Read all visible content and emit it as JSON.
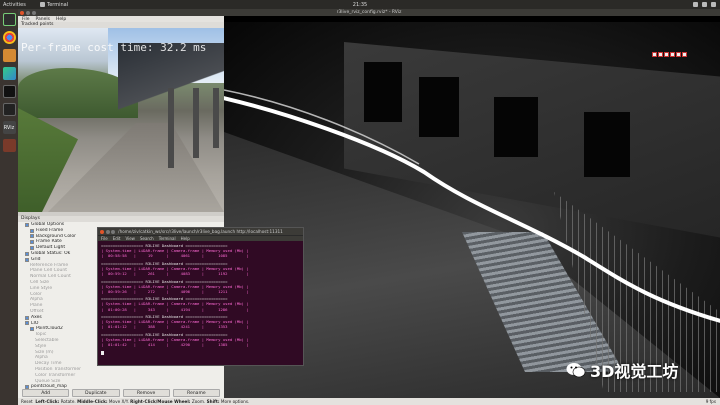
{
  "topbar": {
    "activities": "Activities",
    "app": "Terminal",
    "clock": "21:35"
  },
  "dock": {
    "rviz_label": "RViz"
  },
  "rviz": {
    "window_title": "r3live_rviz_config.rviz* - RViz",
    "menu": [
      "File",
      "Panels",
      "Help"
    ],
    "tracked_points_title": "Tracked points",
    "overlay_text": "Per-frame cost time: 32.2 ms"
  },
  "displays": {
    "title": "Displays",
    "rows": [
      {
        "label": "Global Options",
        "indent": 1,
        "dim": false
      },
      {
        "label": "Fixed Frame",
        "indent": 2,
        "dim": false
      },
      {
        "label": "Background Color",
        "indent": 2,
        "dim": false
      },
      {
        "label": "Frame Rate",
        "indent": 2,
        "dim": false
      },
      {
        "label": "Default Light",
        "indent": 2,
        "dim": false
      },
      {
        "label": "Global Status: Ok",
        "indent": 1,
        "dim": false
      },
      {
        "label": "Grid",
        "indent": 1,
        "dim": false
      },
      {
        "label": "Reference Frame",
        "indent": 2,
        "dim": true
      },
      {
        "label": "Plane Cell Count",
        "indent": 2,
        "dim": true
      },
      {
        "label": "Normal Cell Count",
        "indent": 2,
        "dim": true
      },
      {
        "label": "Cell Size",
        "indent": 2,
        "dim": true
      },
      {
        "label": "Line Style",
        "indent": 2,
        "dim": true
      },
      {
        "label": "Color",
        "indent": 2,
        "dim": true
      },
      {
        "label": "Alpha",
        "indent": 2,
        "dim": true
      },
      {
        "label": "Plane",
        "indent": 2,
        "dim": true
      },
      {
        "label": "Offset",
        "indent": 2,
        "dim": true
      },
      {
        "label": "Axes",
        "indent": 1,
        "dim": false
      },
      {
        "label": "LIO",
        "indent": 1,
        "dim": false
      },
      {
        "label": "PointCloud2",
        "indent": 2,
        "dim": false
      },
      {
        "label": "Topic",
        "indent": 3,
        "dim": true
      },
      {
        "label": "Selectable",
        "indent": 3,
        "dim": true
      },
      {
        "label": "Style",
        "indent": 3,
        "dim": true
      },
      {
        "label": "Size (m)",
        "indent": 3,
        "dim": true
      },
      {
        "label": "Alpha",
        "indent": 3,
        "dim": true
      },
      {
        "label": "Decay Time",
        "indent": 3,
        "dim": true
      },
      {
        "label": "Position Transformer",
        "indent": 3,
        "dim": true
      },
      {
        "label": "Color Transformer",
        "indent": 3,
        "dim": true
      },
      {
        "label": "Queue Size",
        "indent": 3,
        "dim": true
      },
      {
        "label": "pointcloud_map",
        "indent": 1,
        "dim": false
      }
    ],
    "buttons": [
      "Add",
      "Duplicate",
      "Remove",
      "Rename"
    ]
  },
  "statusbar": {
    "reset": "Reset",
    "left_key": "Left-Click:",
    "left_val": "Rotate.",
    "middle_key": "Middle-Click:",
    "middle_val": "Move X/Y.",
    "right_key": "Right-Click/Mouse Wheel:",
    "right_val": "Zoom.",
    "shift_key": "Shift:",
    "shift_val": "More options.",
    "fps": "9 fps"
  },
  "terminal": {
    "title": "/home/ziv/catkin_ws/src/r3live/launch/r3live_bag.launch http://localhost:11311",
    "menu": [
      "File",
      "Edit",
      "View",
      "Search",
      "Terminal",
      "Help"
    ],
    "blocks": [
      {
        "sep": "================== R3LIVE Dashboard ==================",
        "header": "| System-time | LiDAR-frame | Camera-frame | Memory used (Mb) |",
        "vals": "|  00:58:58   |     19      |     4061     |      1085        |"
      },
      {
        "sep": "================== R3LIVE Dashboard ==================",
        "header": "| System-time | LiDAR-frame | Camera-frame | Memory used (Mb) |",
        "vals": "|  00:59:12   |     261     |     4083     |      1192        |"
      },
      {
        "sep": "================== R3LIVE Dashboard ==================",
        "header": "| System-time | LiDAR-frame | Camera-frame | Memory used (Mb) |",
        "vals": "|  00:59:26   |     272     |     4096     |      1211        |"
      },
      {
        "sep": "================== R3LIVE Dashboard ==================",
        "header": "| System-time | LiDAR-frame | Camera-frame | Memory used (Mb) |",
        "vals": "|  01:00:28   |     343     |     4194     |      1286        |"
      },
      {
        "sep": "================== R3LIVE Dashboard ==================",
        "header": "| System-time | LiDAR-frame | Camera-frame | Memory used (Mb) |",
        "vals": "|  01:01:12   |     388     |     4241     |      1353        |"
      },
      {
        "sep": "================== R3LIVE Dashboard ==================",
        "header": "| System-time | LiDAR-frame | Camera-frame | Memory used (Mb) |",
        "vals": "|  01:01:42   |     414     |     4290     |      1385        |"
      }
    ]
  },
  "watermark": {
    "text": "3D视觉工坊"
  }
}
